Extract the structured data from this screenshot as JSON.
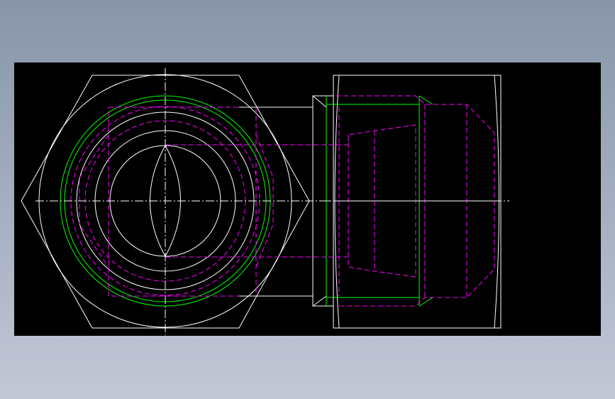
{
  "viewport": {
    "background": "#000000",
    "page_gradient": [
      "#8795a9",
      "#a6b0c2",
      "#c3c8d6"
    ]
  },
  "drawing": {
    "colors": {
      "outline": "#ffffff",
      "hidden": "#ff00ff",
      "thread": "#00ff00",
      "centerline": "#ffffff"
    },
    "views": [
      "front-view-hex-nut",
      "side-view-hex-nut"
    ]
  }
}
